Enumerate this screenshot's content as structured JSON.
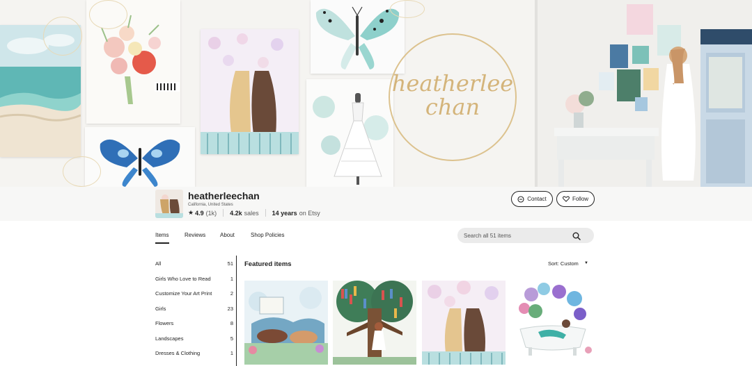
{
  "banner": {
    "logo_text_line1": "heatherlee",
    "logo_text_line2": "chan",
    "seal_text_line1": "heatherlee",
    "seal_text_line2": "chan"
  },
  "shop": {
    "name": "heatherleechan",
    "location": "California, United States",
    "rating": "4.9",
    "rating_count": "(1k)",
    "sales_count": "4.2k",
    "sales_label": "sales",
    "years": "14 years",
    "years_suffix": "on Etsy",
    "contact_label": "Contact",
    "follow_label": "Follow"
  },
  "tabs": [
    {
      "label": "Items",
      "active": true
    },
    {
      "label": "Reviews"
    },
    {
      "label": "About"
    },
    {
      "label": "Shop Policies"
    }
  ],
  "search": {
    "placeholder": "Search all 51 items"
  },
  "sections": [
    {
      "label": "All",
      "count": "51"
    },
    {
      "label": "Girls Who Love to Read",
      "count": "1"
    },
    {
      "label": "Customize Your Art Print",
      "count": "2"
    },
    {
      "label": "Girls",
      "count": "23"
    },
    {
      "label": "Flowers",
      "count": "8"
    },
    {
      "label": "Landscapes",
      "count": "5"
    },
    {
      "label": "Dresses & Clothing",
      "count": "1"
    }
  ],
  "featured": {
    "title": "Featured items",
    "sort_label": "Sort: Custom",
    "items": [
      {
        "icon": "girls-reading-painting"
      },
      {
        "icon": "book-tree-painting"
      },
      {
        "icon": "two-girls-painting"
      },
      {
        "icon": "mermaid-bath-painting"
      }
    ]
  },
  "colors": {
    "accent": "#222222",
    "search_bg": "#ebebeb",
    "logo_gold": "#d4b47a"
  }
}
